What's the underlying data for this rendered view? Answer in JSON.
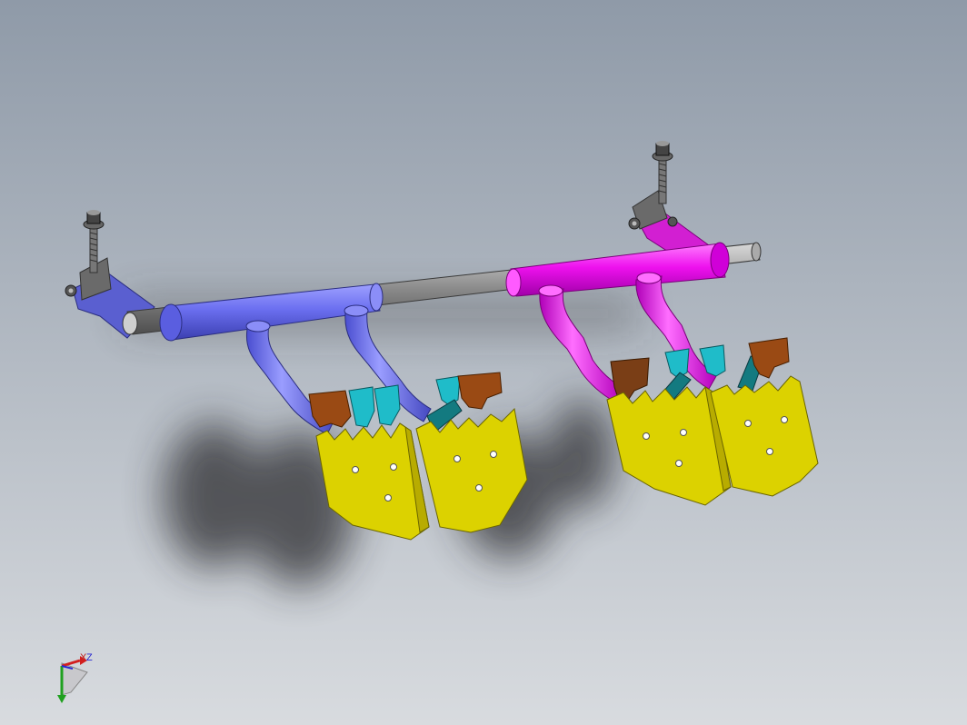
{
  "viewport": {
    "background_top": "#8f9aa8",
    "background_bottom": "#d6d9dd"
  },
  "model": {
    "parts": [
      {
        "name": "left-mounting-bracket",
        "color": "#5a5fd0"
      },
      {
        "name": "right-mounting-bracket",
        "color": "#d21fd2"
      },
      {
        "name": "left-tube",
        "color": "#6b6ff0"
      },
      {
        "name": "center-shaft",
        "color": "#8a8a8a"
      },
      {
        "name": "right-tube",
        "color": "#ee11ee"
      },
      {
        "name": "shovel-blade",
        "color": "#dcd200"
      },
      {
        "name": "brown-tab",
        "color": "#9a4a14"
      },
      {
        "name": "cyan-tab",
        "color": "#1fbcc9"
      }
    ]
  },
  "triad": {
    "x_label": "X",
    "z_label": "Z",
    "x_color": "#d21f1f",
    "y_color": "#1fa01f",
    "z_color": "#2a2ad0"
  }
}
